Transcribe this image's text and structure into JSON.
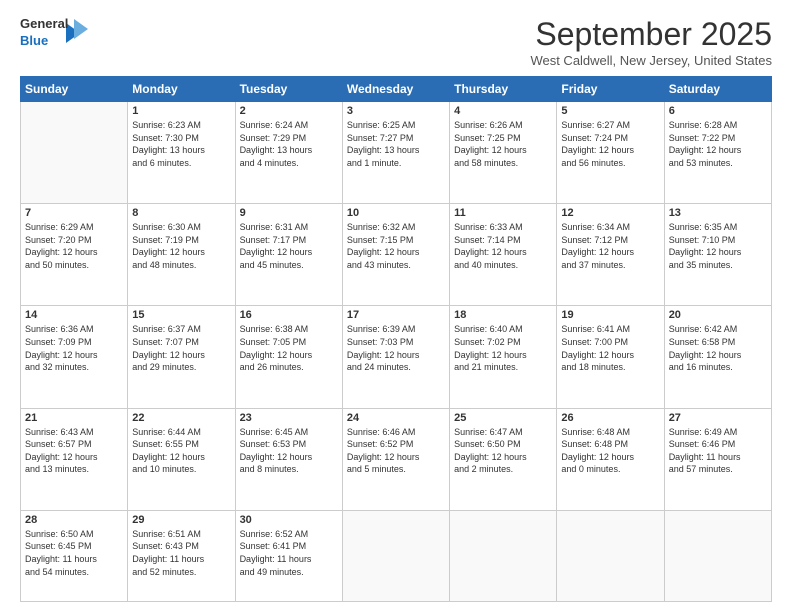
{
  "logo": {
    "line1": "General",
    "line2": "Blue"
  },
  "title": "September 2025",
  "location": "West Caldwell, New Jersey, United States",
  "weekdays": [
    "Sunday",
    "Monday",
    "Tuesday",
    "Wednesday",
    "Thursday",
    "Friday",
    "Saturday"
  ],
  "weeks": [
    [
      {
        "day": "",
        "info": ""
      },
      {
        "day": "1",
        "info": "Sunrise: 6:23 AM\nSunset: 7:30 PM\nDaylight: 13 hours\nand 6 minutes."
      },
      {
        "day": "2",
        "info": "Sunrise: 6:24 AM\nSunset: 7:29 PM\nDaylight: 13 hours\nand 4 minutes."
      },
      {
        "day": "3",
        "info": "Sunrise: 6:25 AM\nSunset: 7:27 PM\nDaylight: 13 hours\nand 1 minute."
      },
      {
        "day": "4",
        "info": "Sunrise: 6:26 AM\nSunset: 7:25 PM\nDaylight: 12 hours\nand 58 minutes."
      },
      {
        "day": "5",
        "info": "Sunrise: 6:27 AM\nSunset: 7:24 PM\nDaylight: 12 hours\nand 56 minutes."
      },
      {
        "day": "6",
        "info": "Sunrise: 6:28 AM\nSunset: 7:22 PM\nDaylight: 12 hours\nand 53 minutes."
      }
    ],
    [
      {
        "day": "7",
        "info": "Sunrise: 6:29 AM\nSunset: 7:20 PM\nDaylight: 12 hours\nand 50 minutes."
      },
      {
        "day": "8",
        "info": "Sunrise: 6:30 AM\nSunset: 7:19 PM\nDaylight: 12 hours\nand 48 minutes."
      },
      {
        "day": "9",
        "info": "Sunrise: 6:31 AM\nSunset: 7:17 PM\nDaylight: 12 hours\nand 45 minutes."
      },
      {
        "day": "10",
        "info": "Sunrise: 6:32 AM\nSunset: 7:15 PM\nDaylight: 12 hours\nand 43 minutes."
      },
      {
        "day": "11",
        "info": "Sunrise: 6:33 AM\nSunset: 7:14 PM\nDaylight: 12 hours\nand 40 minutes."
      },
      {
        "day": "12",
        "info": "Sunrise: 6:34 AM\nSunset: 7:12 PM\nDaylight: 12 hours\nand 37 minutes."
      },
      {
        "day": "13",
        "info": "Sunrise: 6:35 AM\nSunset: 7:10 PM\nDaylight: 12 hours\nand 35 minutes."
      }
    ],
    [
      {
        "day": "14",
        "info": "Sunrise: 6:36 AM\nSunset: 7:09 PM\nDaylight: 12 hours\nand 32 minutes."
      },
      {
        "day": "15",
        "info": "Sunrise: 6:37 AM\nSunset: 7:07 PM\nDaylight: 12 hours\nand 29 minutes."
      },
      {
        "day": "16",
        "info": "Sunrise: 6:38 AM\nSunset: 7:05 PM\nDaylight: 12 hours\nand 26 minutes."
      },
      {
        "day": "17",
        "info": "Sunrise: 6:39 AM\nSunset: 7:03 PM\nDaylight: 12 hours\nand 24 minutes."
      },
      {
        "day": "18",
        "info": "Sunrise: 6:40 AM\nSunset: 7:02 PM\nDaylight: 12 hours\nand 21 minutes."
      },
      {
        "day": "19",
        "info": "Sunrise: 6:41 AM\nSunset: 7:00 PM\nDaylight: 12 hours\nand 18 minutes."
      },
      {
        "day": "20",
        "info": "Sunrise: 6:42 AM\nSunset: 6:58 PM\nDaylight: 12 hours\nand 16 minutes."
      }
    ],
    [
      {
        "day": "21",
        "info": "Sunrise: 6:43 AM\nSunset: 6:57 PM\nDaylight: 12 hours\nand 13 minutes."
      },
      {
        "day": "22",
        "info": "Sunrise: 6:44 AM\nSunset: 6:55 PM\nDaylight: 12 hours\nand 10 minutes."
      },
      {
        "day": "23",
        "info": "Sunrise: 6:45 AM\nSunset: 6:53 PM\nDaylight: 12 hours\nand 8 minutes."
      },
      {
        "day": "24",
        "info": "Sunrise: 6:46 AM\nSunset: 6:52 PM\nDaylight: 12 hours\nand 5 minutes."
      },
      {
        "day": "25",
        "info": "Sunrise: 6:47 AM\nSunset: 6:50 PM\nDaylight: 12 hours\nand 2 minutes."
      },
      {
        "day": "26",
        "info": "Sunrise: 6:48 AM\nSunset: 6:48 PM\nDaylight: 12 hours\nand 0 minutes."
      },
      {
        "day": "27",
        "info": "Sunrise: 6:49 AM\nSunset: 6:46 PM\nDaylight: 11 hours\nand 57 minutes."
      }
    ],
    [
      {
        "day": "28",
        "info": "Sunrise: 6:50 AM\nSunset: 6:45 PM\nDaylight: 11 hours\nand 54 minutes."
      },
      {
        "day": "29",
        "info": "Sunrise: 6:51 AM\nSunset: 6:43 PM\nDaylight: 11 hours\nand 52 minutes."
      },
      {
        "day": "30",
        "info": "Sunrise: 6:52 AM\nSunset: 6:41 PM\nDaylight: 11 hours\nand 49 minutes."
      },
      {
        "day": "",
        "info": ""
      },
      {
        "day": "",
        "info": ""
      },
      {
        "day": "",
        "info": ""
      },
      {
        "day": "",
        "info": ""
      }
    ]
  ]
}
